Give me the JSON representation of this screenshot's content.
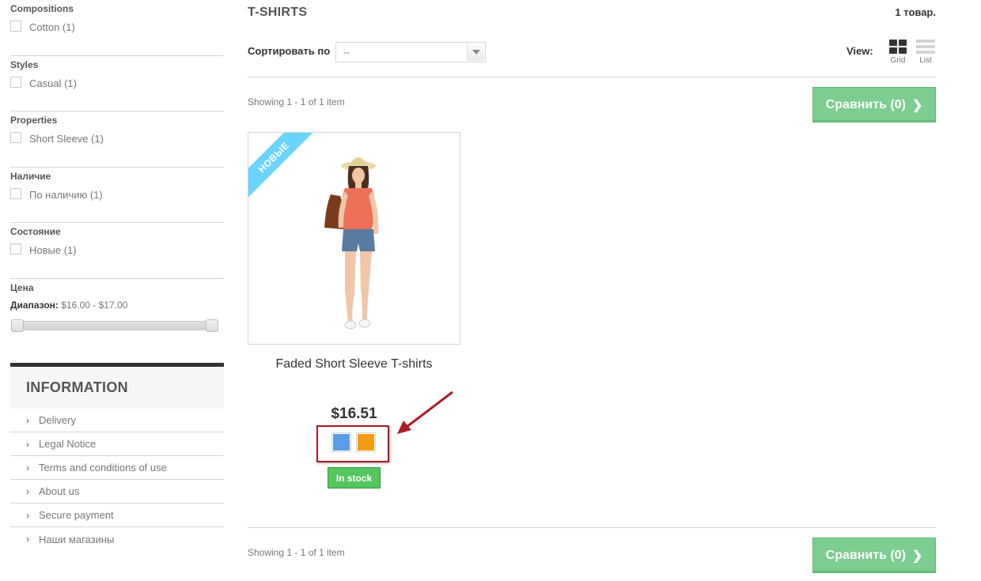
{
  "filters": [
    {
      "title": "Compositions",
      "option": "Cotton (1)"
    },
    {
      "title": "Styles",
      "option": "Casual (1)"
    },
    {
      "title": "Properties",
      "option": "Short Sleeve (1)"
    },
    {
      "title": "Наличие",
      "option": "По наличию (1)"
    },
    {
      "title": "Состояние",
      "option": "Новые (1)"
    }
  ],
  "price_filter": {
    "title": "Цена",
    "range_label": "Диапазон:",
    "range_value": "$16.00 - $17.00"
  },
  "information": {
    "title": "INFORMATION",
    "items": [
      "Delivery",
      "Legal Notice",
      "Terms and conditions of use",
      "About us",
      "Secure payment",
      "Наши магазины"
    ]
  },
  "category": {
    "title": "T-SHIRTS",
    "count": "1 товар."
  },
  "sort": {
    "label": "Сортировать по",
    "value": "--"
  },
  "view": {
    "label": "View:",
    "grid": "Grid",
    "list": "List"
  },
  "pagination": {
    "showing": "Showing 1 - 1 of 1 item"
  },
  "compare_button": "Сравнить (0)",
  "product": {
    "badge": "НОВЫЕ",
    "name": "Faded Short Sleeve T-shirts",
    "price": "$16.51",
    "colors": [
      "#5b9de8",
      "#f39c11"
    ],
    "stock": "In stock"
  },
  "colors": {
    "compare_green": "#7ccd8e",
    "stock_green": "#55c65e",
    "ribbon_blue": "#6ad4ff",
    "annotation_red": "#a81d24"
  }
}
